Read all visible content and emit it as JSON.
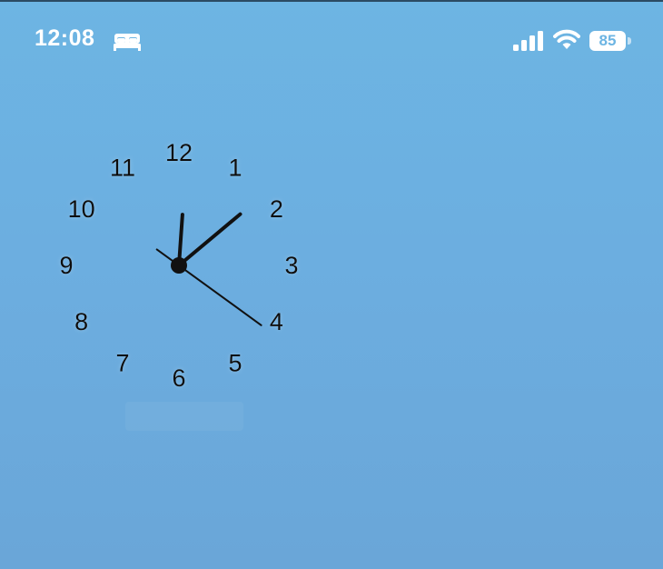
{
  "status_bar": {
    "time": "12:08",
    "battery_level": "85",
    "icons": [
      "bed-icon",
      "cellular-signal-icon",
      "wifi-icon",
      "battery-icon"
    ]
  },
  "clock": {
    "numerals": [
      "12",
      "1",
      "2",
      "3",
      "4",
      "5",
      "6",
      "7",
      "8",
      "9",
      "10",
      "11"
    ],
    "time_shown": {
      "hour": 12,
      "minute": 8,
      "second": 21
    }
  },
  "colors": {
    "wallpaper_top": "#6db5e3",
    "wallpaper_bottom": "#6aa6d8",
    "clock_ink": "#111111",
    "status_text": "#ffffff"
  }
}
